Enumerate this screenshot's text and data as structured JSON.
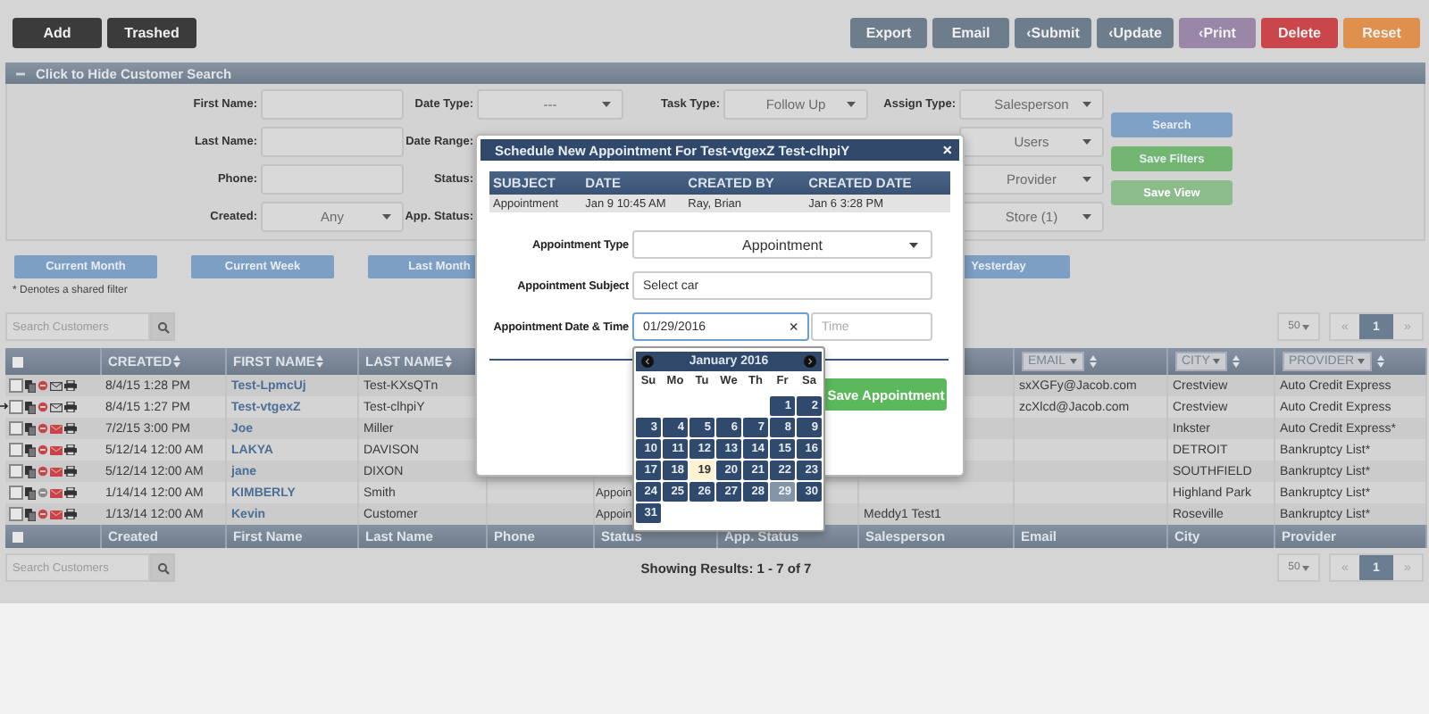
{
  "toolbar": {
    "left": [
      {
        "label": "Add",
        "kind": "dark"
      },
      {
        "label": "Trashed",
        "kind": "dark"
      }
    ],
    "right": [
      {
        "label": "Export",
        "kind": "slate"
      },
      {
        "label": "Email",
        "kind": "slate"
      },
      {
        "label": "‹Submit",
        "kind": "slate"
      },
      {
        "label": "‹Update",
        "kind": "slate"
      },
      {
        "label": "‹Print",
        "kind": "purple"
      },
      {
        "label": "Delete",
        "kind": "red"
      },
      {
        "label": "Reset",
        "kind": "orange"
      }
    ]
  },
  "search_panel": {
    "title": "Click to Hide Customer Search",
    "filter_rows": [
      [
        {
          "label": "First Name:",
          "kind": "text"
        },
        {
          "label": "Date Type:",
          "kind": "select",
          "value": "---"
        },
        {
          "label": "Task Type:",
          "kind": "select",
          "value": "Follow Up"
        },
        {
          "label": "Assign Type:",
          "kind": "select",
          "value": "Salesperson"
        }
      ],
      [
        {
          "label": "Last Name:",
          "kind": "text"
        },
        {
          "label": "Date Range:",
          "kind": "covered"
        },
        {
          "kind": "covered"
        },
        {
          "kind": "select",
          "value": "Users"
        }
      ],
      [
        {
          "label": "Phone:",
          "kind": "text"
        },
        {
          "label": "Status:",
          "kind": "covered"
        },
        {
          "kind": "covered"
        },
        {
          "kind": "select",
          "value": "Provider"
        }
      ],
      [
        {
          "label": "Created:",
          "kind": "select",
          "value": "Any"
        },
        {
          "label": "App. Status:",
          "kind": "covered"
        },
        {
          "kind": "covered"
        },
        {
          "kind": "select",
          "value": "Store (1)"
        }
      ]
    ],
    "buttons": [
      {
        "label": "Search",
        "kind": "primary",
        "disabled": false
      },
      {
        "label": "Save Filters",
        "kind": "success",
        "disabled": false
      },
      {
        "label": "Save View",
        "kind": "success",
        "disabled": true
      }
    ]
  },
  "quick_filters": [
    {
      "label": "Current Month"
    },
    {
      "label": "Current Week"
    },
    {
      "label": "Last Month"
    },
    {
      "label": "Yesterday"
    }
  ],
  "shared_filter_note": "* Denotes a shared filter",
  "top_bar": {
    "search": {
      "placeholder": "Search Customers"
    },
    "page_size": "50",
    "pagination": [
      {
        "label": "«",
        "selected": false,
        "disabled": true
      },
      {
        "label": "1",
        "selected": true,
        "disabled": false
      },
      {
        "label": "»",
        "selected": false,
        "disabled": true
      }
    ]
  },
  "table": {
    "header_checkbox": {
      "checked": false
    },
    "columns": [
      {
        "header": "CREATED",
        "kind": "sort"
      },
      {
        "header": "FIRST NAME",
        "kind": "sort",
        "link": true
      },
      {
        "header": "LAST NAME",
        "kind": "sort"
      },
      {
        "kind": "covered"
      },
      {
        "kind": "covered"
      },
      {
        "kind": "covered"
      },
      {
        "kind": "covered"
      },
      {
        "header": "EMAIL",
        "kind": "filter"
      },
      {
        "header": "CITY",
        "kind": "filter"
      },
      {
        "header": "PROVIDER",
        "kind": "filter"
      }
    ],
    "rows": [
      {
        "current": false,
        "checked": false,
        "circle_active": true,
        "mail_flag": false,
        "cells": [
          "8/4/15 1:28 PM",
          "Test-LpmcUj",
          "Test-KXsQTn",
          null,
          null,
          null,
          null,
          "sxXGFy@Jacob.com",
          "Crestview",
          "Auto Credit Express"
        ]
      },
      {
        "current": true,
        "checked": false,
        "circle_active": true,
        "mail_flag": false,
        "cells": [
          "8/4/15 1:27 PM",
          "Test-vtgexZ",
          "Test-clhpiY",
          null,
          null,
          null,
          null,
          "zcXlcd@Jacob.com",
          "Crestview",
          "Auto Credit Express"
        ]
      },
      {
        "current": false,
        "checked": false,
        "circle_active": true,
        "mail_flag": true,
        "cells": [
          "7/2/15 3:00 PM",
          "Joe",
          "Miller",
          null,
          null,
          null,
          null,
          null,
          "Inkster",
          "Auto Credit Express*"
        ]
      },
      {
        "current": false,
        "checked": false,
        "circle_active": true,
        "mail_flag": true,
        "cells": [
          "5/12/14 12:00 AM",
          "LAKYA",
          "DAVISON",
          null,
          null,
          null,
          null,
          null,
          "DETROIT",
          "Bankruptcy List*"
        ]
      },
      {
        "current": false,
        "checked": false,
        "circle_active": true,
        "mail_flag": true,
        "cells": [
          "5/12/14 12:00 AM",
          "jane",
          "DIXON",
          null,
          null,
          null,
          null,
          null,
          "SOUTHFIELD",
          "Bankruptcy List*"
        ]
      },
      {
        "current": false,
        "checked": false,
        "circle_active": false,
        "mail_flag": true,
        "cells": [
          "1/14/14 12:00 AM",
          "KIMBERLY",
          "Smith",
          null,
          "Appoin",
          null,
          null,
          null,
          "Highland Park",
          "Bankruptcy List*"
        ]
      },
      {
        "current": false,
        "checked": false,
        "circle_active": true,
        "mail_flag": true,
        "cells": [
          "1/13/14 12:00 AM",
          "Kevin",
          "Customer",
          null,
          "Appoin",
          null,
          "Meddy1 Test1",
          null,
          "Roseville",
          "Bankruptcy List*"
        ]
      }
    ],
    "footer_checkbox": {
      "checked": false
    },
    "footer_columns": [
      {
        "kind": "text",
        "label": "Created"
      },
      {
        "kind": "text",
        "label": "First Name"
      },
      {
        "kind": "text",
        "label": "Last Name"
      },
      {
        "kind": "text",
        "label": "Phone"
      },
      {
        "kind": "text",
        "label": "Status"
      },
      {
        "kind": "text",
        "label": "App. Status"
      },
      {
        "kind": "text",
        "label": "Salesperson"
      },
      {
        "kind": "text",
        "label": "Email"
      },
      {
        "kind": "text",
        "label": "City"
      },
      {
        "kind": "text",
        "label": "Provider"
      }
    ]
  },
  "footer_bar": {
    "search": {
      "placeholder": "Search Customers"
    },
    "summary": "Showing Results: 1 - 7 of 7",
    "page_size": "50",
    "pagination": [
      {
        "label": "«",
        "selected": false,
        "disabled": true
      },
      {
        "label": "1",
        "selected": true,
        "disabled": false
      },
      {
        "label": "»",
        "selected": false,
        "disabled": true
      }
    ]
  },
  "modal": {
    "title": "Schedule New Appointment For Test-vtgexZ Test-clhpiY",
    "close": "×",
    "history": {
      "columns": [
        "SUBJECT",
        "DATE",
        "CREATED BY",
        "CREATED DATE"
      ],
      "rows": [
        [
          "Appointment",
          "Jan 9 10:45 AM",
          "Ray, Brian",
          "Jan 6 3:28 PM"
        ]
      ]
    },
    "form": [
      {
        "label": "Appointment Type",
        "kind": "select",
        "value": "Appointment"
      },
      {
        "label": "Appointment Subject",
        "kind": "text",
        "value": "Select car"
      },
      {
        "label": "Appointment Date & Time",
        "kind": "datetime",
        "value": "01/29/2016",
        "clear": "×",
        "time_placeholder": "Time"
      }
    ],
    "save_button": "Save Appointment"
  },
  "datepicker": {
    "month": "January 2016",
    "weekdays": [
      "Su",
      "Mo",
      "Tu",
      "We",
      "Th",
      "Fr",
      "Sa"
    ],
    "weeks": [
      [
        {
          "kind": "blank"
        },
        {
          "kind": "blank"
        },
        {
          "kind": "blank"
        },
        {
          "kind": "blank"
        },
        {
          "kind": "blank"
        },
        {
          "kind": "day",
          "day": "1",
          "selected": false
        },
        {
          "kind": "day",
          "day": "2",
          "selected": false
        }
      ],
      [
        {
          "kind": "day",
          "day": "3",
          "selected": false
        },
        {
          "kind": "day",
          "day": "4",
          "selected": false
        },
        {
          "kind": "day",
          "day": "5",
          "selected": false
        },
        {
          "kind": "day",
          "day": "6",
          "selected": false
        },
        {
          "kind": "day",
          "day": "7",
          "selected": false
        },
        {
          "kind": "day",
          "day": "8",
          "selected": false
        },
        {
          "kind": "day",
          "day": "9",
          "selected": false
        }
      ],
      [
        {
          "kind": "day",
          "day": "10",
          "selected": false
        },
        {
          "kind": "day",
          "day": "11",
          "selected": false
        },
        {
          "kind": "day",
          "day": "12",
          "selected": false
        },
        {
          "kind": "day",
          "day": "13",
          "selected": false
        },
        {
          "kind": "day",
          "day": "14",
          "selected": false
        },
        {
          "kind": "day",
          "day": "15",
          "selected": false
        },
        {
          "kind": "day",
          "day": "16",
          "selected": false
        }
      ],
      [
        {
          "kind": "day",
          "day": "17",
          "selected": false
        },
        {
          "kind": "day",
          "day": "18",
          "selected": false
        },
        {
          "kind": "today",
          "day": "19",
          "selected": false
        },
        {
          "kind": "day",
          "day": "20",
          "selected": false
        },
        {
          "kind": "day",
          "day": "21",
          "selected": false
        },
        {
          "kind": "day",
          "day": "22",
          "selected": false
        },
        {
          "kind": "day",
          "day": "23",
          "selected": false
        }
      ],
      [
        {
          "kind": "day",
          "day": "24",
          "selected": false
        },
        {
          "kind": "day",
          "day": "25",
          "selected": false
        },
        {
          "kind": "day",
          "day": "26",
          "selected": false
        },
        {
          "kind": "day",
          "day": "27",
          "selected": false
        },
        {
          "kind": "day",
          "day": "28",
          "selected": false
        },
        {
          "kind": "day",
          "day": "29",
          "selected": true
        },
        {
          "kind": "day",
          "day": "30",
          "selected": false
        }
      ],
      [
        {
          "kind": "day",
          "day": "31",
          "selected": false
        }
      ]
    ]
  }
}
